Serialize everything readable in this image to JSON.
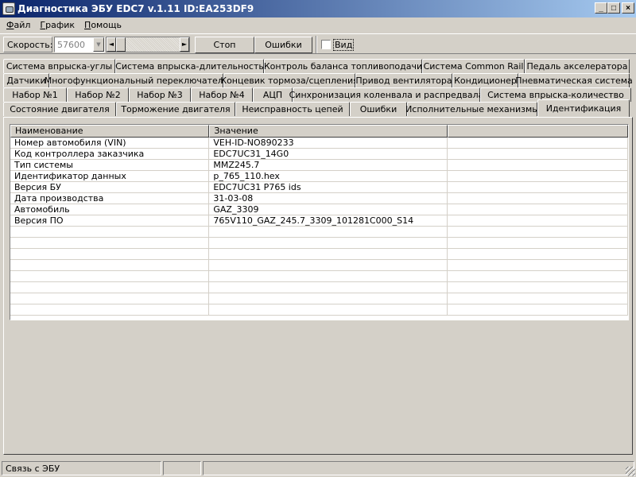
{
  "window": {
    "title": "Диагностика ЭБУ EDC7 v.1.11 ID:EA253DF9",
    "minimize": "_",
    "maximize": "□",
    "close": "×"
  },
  "menu": [
    "Файл",
    "График",
    "Помощь"
  ],
  "toolbar": {
    "speed_label": "Скорость:",
    "speed_value": "57600",
    "stop_label": "Стоп",
    "errors_label": "Ошибки",
    "view_label": "Вид",
    "view_checked": false
  },
  "tabs": {
    "row1": [
      "Система впрыска-углы",
      "Система впрыска-длительность",
      "Контроль баланса топливоподачи",
      "Система Common Rail",
      "Педаль акселератора"
    ],
    "row2": [
      "Датчики",
      "Многофункциональный переключатель",
      "Концевик тормоза/сцепления",
      "Привод вентилятора",
      "Кондиционер",
      "Пневматическая система"
    ],
    "row3": [
      "Набор №1",
      "Набор №2",
      "Набор №3",
      "Набор №4",
      "АЦП",
      "Синхронизация коленвала и распредвала",
      "Система впрыска-количество"
    ],
    "row4": [
      "Состояние двигателя",
      "Торможение двигателя",
      "Неисправность цепей",
      "Ошибки",
      "Исполнительные механизмы",
      "Идентификация"
    ],
    "active": "Идентификация"
  },
  "grid": {
    "columns": [
      "Наименование",
      "Значение",
      ""
    ],
    "rows": [
      [
        "Номер автомобиля (VIN)",
        "VEH-ID-NO890233",
        ""
      ],
      [
        "Код контроллера заказчика",
        "EDC7UC31_14G0",
        ""
      ],
      [
        "Тип системы",
        "MMZ245.7",
        ""
      ],
      [
        "Идентификатор данных",
        "p_765_110.hex",
        ""
      ],
      [
        "Версия БУ",
        "EDC7UC31 P765 ids",
        ""
      ],
      [
        "Дата производства",
        "31-03-08",
        ""
      ],
      [
        "Автомобиль",
        "GAZ_3309",
        ""
      ],
      [
        "Версия ПО",
        "765V110_GAZ_245.7_3309_101281C000_S14",
        ""
      ]
    ],
    "empty_rows": 8
  },
  "status": {
    "connection": "Связь с ЭБУ",
    "panel2": "",
    "panel3": ""
  }
}
